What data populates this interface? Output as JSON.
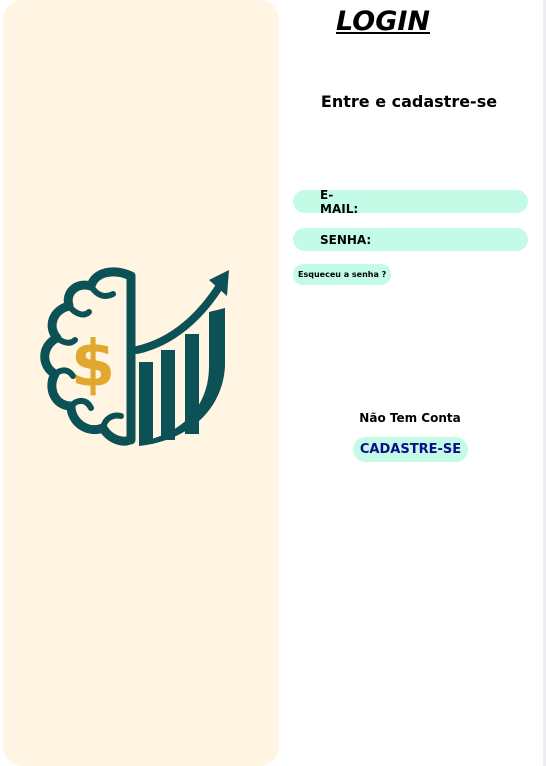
{
  "header": {
    "title": "LOGIN",
    "subtitle": "Entre e cadastre-se"
  },
  "form": {
    "email_label": "E-MAIL:",
    "email_value": "",
    "password_label": "SENHA:",
    "password_value": "",
    "forgot_label": "Esqueceu a senha ?"
  },
  "signup": {
    "prompt": "Não Tem Conta",
    "button_label": "CADASTRE-SE"
  },
  "logo": {
    "icon": "brain-dollar-growth-chart-icon",
    "colors": {
      "primary": "#0b5156",
      "accent": "#e0a82e"
    }
  },
  "colors": {
    "panel_bg": "#fff5e2",
    "field_bg": "#c3fbe7",
    "signup_text": "#0d0d8a"
  }
}
